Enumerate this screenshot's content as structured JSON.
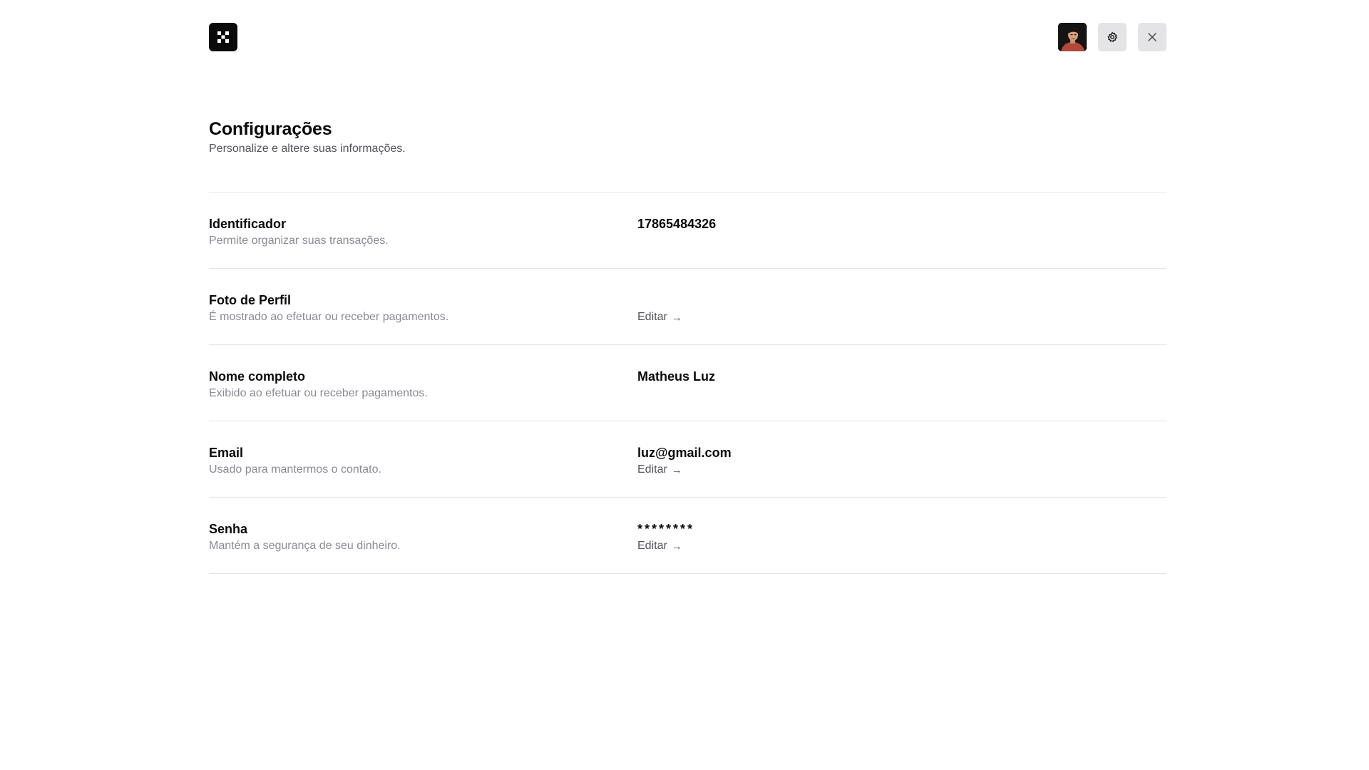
{
  "header": {
    "logo_icon": "logo-grid-icon",
    "avatar_icon": "user-avatar",
    "settings_icon": "gear-icon",
    "close_icon": "close-icon"
  },
  "page": {
    "title": "Configurações",
    "subtitle": "Personalize e altere suas informações."
  },
  "settings": [
    {
      "label": "Identificador",
      "description": "Permite organizar suas transações.",
      "value": "17865484326",
      "edit_label": null
    },
    {
      "label": "Foto de Perfil",
      "description": "É mostrado ao efetuar ou receber pagamentos.",
      "value": null,
      "edit_label": "Editar"
    },
    {
      "label": "Nome completo",
      "description": "Exibido ao efetuar ou receber pagamentos.",
      "value": "Matheus Luz",
      "edit_label": null
    },
    {
      "label": "Email",
      "description": "Usado para mantermos o contato.",
      "value": "luz@gmail.com",
      "edit_label": "Editar"
    },
    {
      "label": "Senha",
      "description": "Mantém a segurança de seu dinheiro.",
      "value": "********",
      "edit_label": "Editar"
    }
  ],
  "edit_arrow": "→",
  "colors": {
    "text": "#0a0a0a",
    "muted": "#8a8a93",
    "link": "#52525b",
    "divider": "#e4e4e7",
    "button_bg": "#e4e4e7"
  }
}
